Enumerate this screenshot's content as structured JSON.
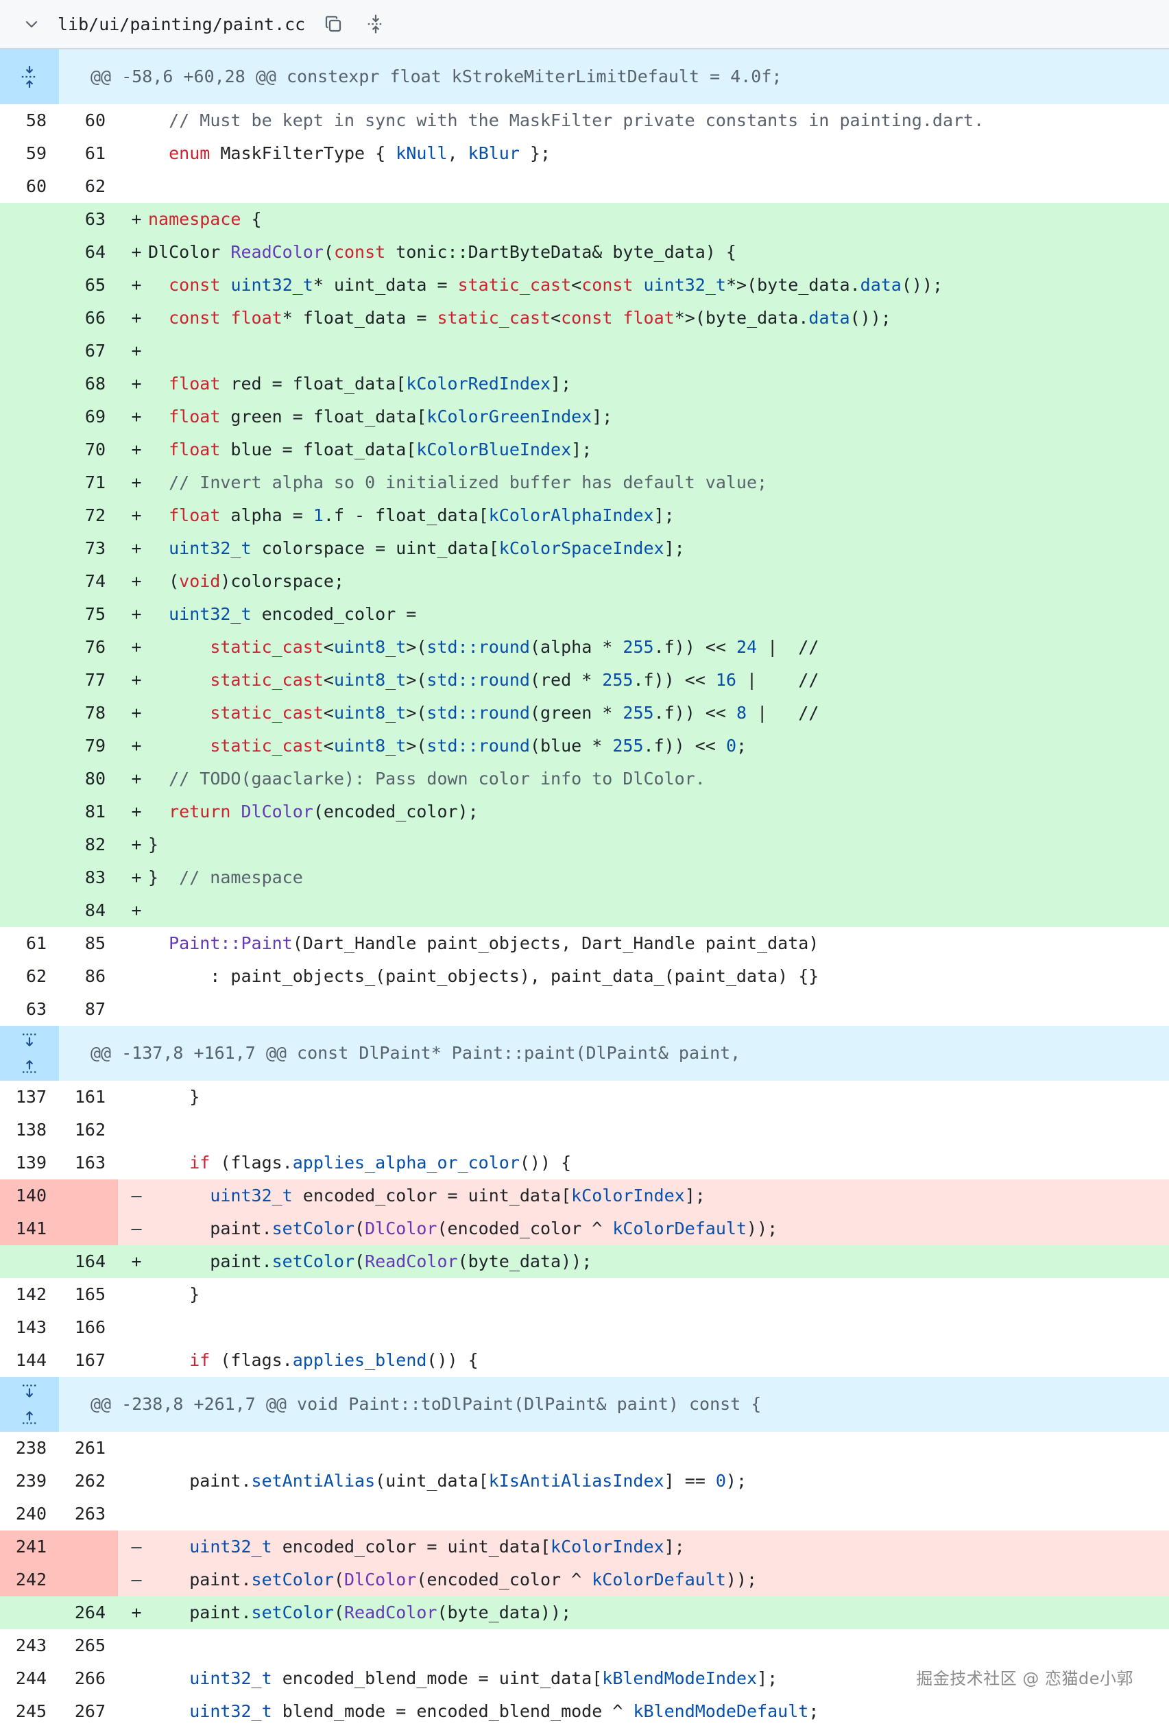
{
  "file": {
    "path": "lib/ui/painting/paint.cc",
    "icons": [
      "chevron-down-icon",
      "copy-icon",
      "expand-vertical-icon"
    ]
  },
  "watermark": "掘金技术社区 @ 恋猫de小郭",
  "colors": {
    "add_bg": "#d1f8d9",
    "del_bg": "#ffe3e1",
    "del_gutter": "#ffc1bc",
    "hunk_bg": "#ddf4ff",
    "hunk_gutter": "#b6e3ff",
    "keyword": "#cf222e",
    "type": "#0550ae",
    "function": "#6639ba",
    "comment": "#59636e"
  },
  "rows": [
    {
      "kind": "hunk",
      "text": "@@ -58,6 +60,28 @@ constexpr float kStrokeMiterLimitDefault = 4.0f;",
      "expand": "up"
    },
    {
      "kind": "ctx",
      "old": "58",
      "new": "60",
      "code": [
        [
          "p",
          "  "
        ],
        [
          "c",
          "// Must be kept in sync with the MaskFilter private constants in painting.dart."
        ]
      ]
    },
    {
      "kind": "ctx",
      "old": "59",
      "new": "61",
      "code": [
        [
          "p",
          "  "
        ],
        [
          "k",
          "enum"
        ],
        [
          "p",
          " MaskFilterType { "
        ],
        [
          "t",
          "kNull"
        ],
        [
          "p",
          ", "
        ],
        [
          "t",
          "kBlur"
        ],
        [
          "p",
          " };"
        ]
      ]
    },
    {
      "kind": "ctx",
      "old": "60",
      "new": "62",
      "code": []
    },
    {
      "kind": "add",
      "old": "",
      "new": "63",
      "code": [
        [
          "k",
          "namespace"
        ],
        [
          "p",
          " {"
        ]
      ]
    },
    {
      "kind": "add",
      "old": "",
      "new": "64",
      "code": [
        [
          "p",
          "DlColor "
        ],
        [
          "f",
          "ReadColor"
        ],
        [
          "p",
          "("
        ],
        [
          "k",
          "const"
        ],
        [
          "p",
          " tonic::DartByteData& byte_data) {"
        ]
      ]
    },
    {
      "kind": "add",
      "old": "",
      "new": "65",
      "code": [
        [
          "p",
          "  "
        ],
        [
          "k",
          "const"
        ],
        [
          "p",
          " "
        ],
        [
          "t",
          "uint32_t"
        ],
        [
          "p",
          "* uint_data = "
        ],
        [
          "k",
          "static_cast"
        ],
        [
          "p",
          "<"
        ],
        [
          "k",
          "const"
        ],
        [
          "p",
          " "
        ],
        [
          "t",
          "uint32_t"
        ],
        [
          "p",
          "*>(byte_data."
        ],
        [
          "t",
          "data"
        ],
        [
          "p",
          "());"
        ]
      ]
    },
    {
      "kind": "add",
      "old": "",
      "new": "66",
      "code": [
        [
          "p",
          "  "
        ],
        [
          "k",
          "const"
        ],
        [
          "p",
          " "
        ],
        [
          "k",
          "float"
        ],
        [
          "p",
          "* float_data = "
        ],
        [
          "k",
          "static_cast"
        ],
        [
          "p",
          "<"
        ],
        [
          "k",
          "const"
        ],
        [
          "p",
          " "
        ],
        [
          "k",
          "float"
        ],
        [
          "p",
          "*>(byte_data."
        ],
        [
          "t",
          "data"
        ],
        [
          "p",
          "());"
        ]
      ]
    },
    {
      "kind": "add",
      "old": "",
      "new": "67",
      "code": []
    },
    {
      "kind": "add",
      "old": "",
      "new": "68",
      "code": [
        [
          "p",
          "  "
        ],
        [
          "k",
          "float"
        ],
        [
          "p",
          " red = float_data["
        ],
        [
          "t",
          "kColorRedIndex"
        ],
        [
          "p",
          "];"
        ]
      ]
    },
    {
      "kind": "add",
      "old": "",
      "new": "69",
      "code": [
        [
          "p",
          "  "
        ],
        [
          "k",
          "float"
        ],
        [
          "p",
          " green = float_data["
        ],
        [
          "t",
          "kColorGreenIndex"
        ],
        [
          "p",
          "];"
        ]
      ]
    },
    {
      "kind": "add",
      "old": "",
      "new": "70",
      "code": [
        [
          "p",
          "  "
        ],
        [
          "k",
          "float"
        ],
        [
          "p",
          " blue = float_data["
        ],
        [
          "t",
          "kColorBlueIndex"
        ],
        [
          "p",
          "];"
        ]
      ]
    },
    {
      "kind": "add",
      "old": "",
      "new": "71",
      "code": [
        [
          "p",
          "  "
        ],
        [
          "c",
          "// Invert alpha so 0 initialized buffer has default value;"
        ]
      ]
    },
    {
      "kind": "add",
      "old": "",
      "new": "72",
      "code": [
        [
          "p",
          "  "
        ],
        [
          "k",
          "float"
        ],
        [
          "p",
          " alpha = "
        ],
        [
          "t",
          "1"
        ],
        [
          "p",
          ".f - float_data["
        ],
        [
          "t",
          "kColorAlphaIndex"
        ],
        [
          "p",
          "];"
        ]
      ]
    },
    {
      "kind": "add",
      "old": "",
      "new": "73",
      "code": [
        [
          "p",
          "  "
        ],
        [
          "t",
          "uint32_t"
        ],
        [
          "p",
          " colorspace = uint_data["
        ],
        [
          "t",
          "kColorSpaceIndex"
        ],
        [
          "p",
          "];"
        ]
      ]
    },
    {
      "kind": "add",
      "old": "",
      "new": "74",
      "code": [
        [
          "p",
          "  ("
        ],
        [
          "k",
          "void"
        ],
        [
          "p",
          ")colorspace;"
        ]
      ]
    },
    {
      "kind": "add",
      "old": "",
      "new": "75",
      "code": [
        [
          "p",
          "  "
        ],
        [
          "t",
          "uint32_t"
        ],
        [
          "p",
          " encoded_color ="
        ]
      ]
    },
    {
      "kind": "add",
      "old": "",
      "new": "76",
      "code": [
        [
          "p",
          "      "
        ],
        [
          "k",
          "static_cast"
        ],
        [
          "p",
          "<"
        ],
        [
          "t",
          "uint8_t"
        ],
        [
          "p",
          ">("
        ],
        [
          "t",
          "std::round"
        ],
        [
          "p",
          "(alpha * "
        ],
        [
          "t",
          "255"
        ],
        [
          "p",
          ".f)) << "
        ],
        [
          "t",
          "24"
        ],
        [
          "p",
          " |  //"
        ]
      ]
    },
    {
      "kind": "add",
      "old": "",
      "new": "77",
      "code": [
        [
          "p",
          "      "
        ],
        [
          "k",
          "static_cast"
        ],
        [
          "p",
          "<"
        ],
        [
          "t",
          "uint8_t"
        ],
        [
          "p",
          ">("
        ],
        [
          "t",
          "std::round"
        ],
        [
          "p",
          "(red * "
        ],
        [
          "t",
          "255"
        ],
        [
          "p",
          ".f)) << "
        ],
        [
          "t",
          "16"
        ],
        [
          "p",
          " |    //"
        ]
      ]
    },
    {
      "kind": "add",
      "old": "",
      "new": "78",
      "code": [
        [
          "p",
          "      "
        ],
        [
          "k",
          "static_cast"
        ],
        [
          "p",
          "<"
        ],
        [
          "t",
          "uint8_t"
        ],
        [
          "p",
          ">("
        ],
        [
          "t",
          "std::round"
        ],
        [
          "p",
          "(green * "
        ],
        [
          "t",
          "255"
        ],
        [
          "p",
          ".f)) << "
        ],
        [
          "t",
          "8"
        ],
        [
          "p",
          " |   //"
        ]
      ]
    },
    {
      "kind": "add",
      "old": "",
      "new": "79",
      "code": [
        [
          "p",
          "      "
        ],
        [
          "k",
          "static_cast"
        ],
        [
          "p",
          "<"
        ],
        [
          "t",
          "uint8_t"
        ],
        [
          "p",
          ">("
        ],
        [
          "t",
          "std::round"
        ],
        [
          "p",
          "(blue * "
        ],
        [
          "t",
          "255"
        ],
        [
          "p",
          ".f)) << "
        ],
        [
          "t",
          "0"
        ],
        [
          "p",
          ";"
        ]
      ]
    },
    {
      "kind": "add",
      "old": "",
      "new": "80",
      "code": [
        [
          "p",
          "  "
        ],
        [
          "c",
          "// TODO(gaaclarke): Pass down color info to DlColor."
        ]
      ]
    },
    {
      "kind": "add",
      "old": "",
      "new": "81",
      "code": [
        [
          "p",
          "  "
        ],
        [
          "k",
          "return"
        ],
        [
          "p",
          " "
        ],
        [
          "f",
          "DlColor"
        ],
        [
          "p",
          "(encoded_color);"
        ]
      ]
    },
    {
      "kind": "add",
      "old": "",
      "new": "82",
      "code": [
        [
          "p",
          "}"
        ]
      ]
    },
    {
      "kind": "add",
      "old": "",
      "new": "83",
      "code": [
        [
          "p",
          "}  "
        ],
        [
          "c",
          "// namespace"
        ]
      ]
    },
    {
      "kind": "add",
      "old": "",
      "new": "84",
      "code": []
    },
    {
      "kind": "ctx",
      "old": "61",
      "new": "85",
      "code": [
        [
          "p",
          "  "
        ],
        [
          "f",
          "Paint::Paint"
        ],
        [
          "p",
          "(Dart_Handle paint_objects, Dart_Handle paint_data)"
        ]
      ]
    },
    {
      "kind": "ctx",
      "old": "62",
      "new": "86",
      "code": [
        [
          "p",
          "      : paint_objects_(paint_objects), paint_data_(paint_data) {}"
        ]
      ]
    },
    {
      "kind": "ctx",
      "old": "63",
      "new": "87",
      "code": []
    },
    {
      "kind": "hunk",
      "text": "@@ -137,8 +161,7 @@ const DlPaint* Paint::paint(DlPaint& paint,",
      "expand": "both"
    },
    {
      "kind": "ctx",
      "old": "137",
      "new": "161",
      "code": [
        [
          "p",
          "    }"
        ]
      ]
    },
    {
      "kind": "ctx",
      "old": "138",
      "new": "162",
      "code": []
    },
    {
      "kind": "ctx",
      "old": "139",
      "new": "163",
      "code": [
        [
          "p",
          "    "
        ],
        [
          "k",
          "if"
        ],
        [
          "p",
          " (flags."
        ],
        [
          "t",
          "applies_alpha_or_color"
        ],
        [
          "p",
          "()) {"
        ]
      ]
    },
    {
      "kind": "del",
      "old": "140",
      "new": "",
      "code": [
        [
          "p",
          "      "
        ],
        [
          "t",
          "uint32_t"
        ],
        [
          "p",
          " encoded_color = uint_data["
        ],
        [
          "t",
          "kColorIndex"
        ],
        [
          "p",
          "];"
        ]
      ]
    },
    {
      "kind": "del",
      "old": "141",
      "new": "",
      "code": [
        [
          "p",
          "      paint."
        ],
        [
          "t",
          "setColor"
        ],
        [
          "p",
          "("
        ],
        [
          "f",
          "DlColor"
        ],
        [
          "p",
          "(encoded_color ^ "
        ],
        [
          "t",
          "kColorDefault"
        ],
        [
          "p",
          "));"
        ]
      ]
    },
    {
      "kind": "add",
      "old": "",
      "new": "164",
      "code": [
        [
          "p",
          "      paint."
        ],
        [
          "t",
          "setColor"
        ],
        [
          "p",
          "("
        ],
        [
          "f",
          "ReadColor"
        ],
        [
          "p",
          "(byte_data));"
        ]
      ]
    },
    {
      "kind": "ctx",
      "old": "142",
      "new": "165",
      "code": [
        [
          "p",
          "    }"
        ]
      ]
    },
    {
      "kind": "ctx",
      "old": "143",
      "new": "166",
      "code": []
    },
    {
      "kind": "ctx",
      "old": "144",
      "new": "167",
      "code": [
        [
          "p",
          "    "
        ],
        [
          "k",
          "if"
        ],
        [
          "p",
          " (flags."
        ],
        [
          "t",
          "applies_blend"
        ],
        [
          "p",
          "()) {"
        ]
      ]
    },
    {
      "kind": "hunk",
      "text": "@@ -238,8 +261,7 @@ void Paint::toDlPaint(DlPaint& paint) const {",
      "expand": "both"
    },
    {
      "kind": "ctx",
      "old": "238",
      "new": "261",
      "code": []
    },
    {
      "kind": "ctx",
      "old": "239",
      "new": "262",
      "code": [
        [
          "p",
          "    paint."
        ],
        [
          "t",
          "setAntiAlias"
        ],
        [
          "p",
          "(uint_data["
        ],
        [
          "t",
          "kIsAntiAliasIndex"
        ],
        [
          "p",
          "] == "
        ],
        [
          "t",
          "0"
        ],
        [
          "p",
          ");"
        ]
      ]
    },
    {
      "kind": "ctx",
      "old": "240",
      "new": "263",
      "code": []
    },
    {
      "kind": "del",
      "old": "241",
      "new": "",
      "code": [
        [
          "p",
          "    "
        ],
        [
          "t",
          "uint32_t"
        ],
        [
          "p",
          " encoded_color = uint_data["
        ],
        [
          "t",
          "kColorIndex"
        ],
        [
          "p",
          "];"
        ]
      ]
    },
    {
      "kind": "del",
      "old": "242",
      "new": "",
      "code": [
        [
          "p",
          "    paint."
        ],
        [
          "t",
          "setColor"
        ],
        [
          "p",
          "("
        ],
        [
          "f",
          "DlColor"
        ],
        [
          "p",
          "(encoded_color ^ "
        ],
        [
          "t",
          "kColorDefault"
        ],
        [
          "p",
          "));"
        ]
      ]
    },
    {
      "kind": "add",
      "old": "",
      "new": "264",
      "code": [
        [
          "p",
          "    paint."
        ],
        [
          "t",
          "setColor"
        ],
        [
          "p",
          "("
        ],
        [
          "f",
          "ReadColor"
        ],
        [
          "p",
          "(byte_data));"
        ]
      ]
    },
    {
      "kind": "ctx",
      "old": "243",
      "new": "265",
      "code": []
    },
    {
      "kind": "ctx",
      "old": "244",
      "new": "266",
      "code": [
        [
          "p",
          "    "
        ],
        [
          "t",
          "uint32_t"
        ],
        [
          "p",
          " encoded_blend_mode = uint_data["
        ],
        [
          "t",
          "kBlendModeIndex"
        ],
        [
          "p",
          "];"
        ]
      ]
    },
    {
      "kind": "ctx",
      "old": "245",
      "new": "267",
      "code": [
        [
          "p",
          "    "
        ],
        [
          "t",
          "uint32_t"
        ],
        [
          "p",
          " blend_mode = encoded_blend_mode ^ "
        ],
        [
          "t",
          "kBlendModeDefault"
        ],
        [
          "p",
          ";"
        ]
      ]
    }
  ]
}
